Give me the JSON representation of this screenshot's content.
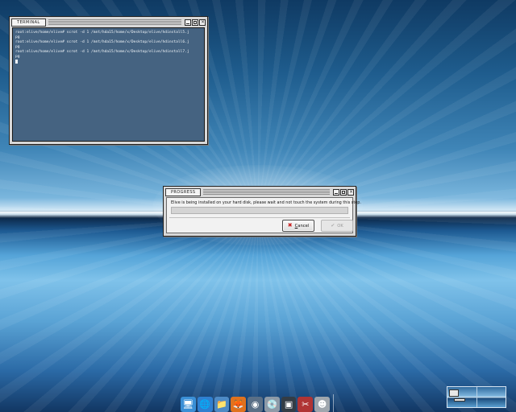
{
  "terminal": {
    "title": "Terminal",
    "lines": [
      "root:elive/home/elive# scrot -d 1 /mnt/hda15/home/x/Desktop/elive/hdinstall5.j",
      "pg",
      "root:elive/home/elive# scrot -d 1 /mnt/hda15/home/x/Desktop/elive/hdinstall6.j",
      "pg",
      "root:elive/home/elive# scrot -d 1 /mnt/hda15/home/x/Desktop/elive/hdinstall7.j",
      "pg"
    ]
  },
  "progress": {
    "title": "Progress",
    "message": "Elive is being installed on your hard disk, please wait and not touch the system during this step.",
    "progress_fraction": 0.0,
    "cancel": {
      "underline": "C",
      "rest": "ancel"
    },
    "ok": {
      "label": "OK"
    }
  },
  "dock": {
    "items": [
      {
        "name": "computer-icon",
        "color": "#3a8fd6",
        "glyph": "🖥"
      },
      {
        "name": "network-globe-icon",
        "color": "#2f7fd0",
        "glyph": "🌐"
      },
      {
        "name": "file-manager-icon",
        "color": "#4d8ac5",
        "glyph": "📁"
      },
      {
        "name": "firefox-icon",
        "color": "#e0721e",
        "glyph": "🦊"
      },
      {
        "name": "media-player-icon",
        "color": "#5a6f86",
        "glyph": "◉"
      },
      {
        "name": "cd-burner-icon",
        "color": "#8e9aa7",
        "glyph": "💿"
      },
      {
        "name": "terminal-icon",
        "color": "#333c45",
        "glyph": "▣"
      },
      {
        "name": "tools-icon",
        "color": "#b03434",
        "glyph": "✂"
      },
      {
        "name": "user-avatar-icon",
        "color": "#9fa6ad",
        "glyph": "☻"
      }
    ]
  },
  "colors": {
    "accent": "#2b6aa6",
    "cancel_icon": "#c81e1e"
  }
}
